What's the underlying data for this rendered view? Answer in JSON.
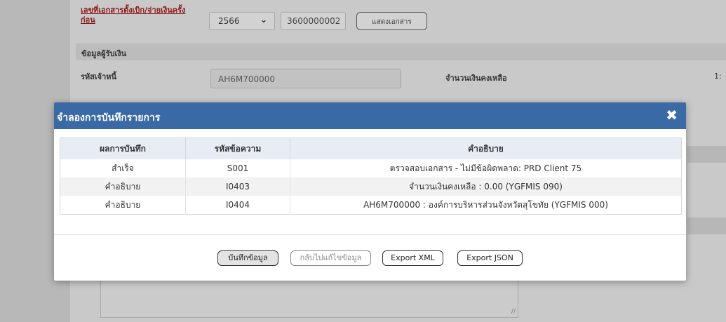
{
  "background": {
    "prev_doc_label": "เลขที่เอกสารตั้งเบิก/จ่ายเงินครั้งก่อน",
    "year_select_value": "2566",
    "doc_number_value": "3600000002",
    "show_doc_button": "แสดงเอกสาร",
    "section_title": "ข้อมูลผู้รับเงิน",
    "creditor_label": "รหัสเจ้าหนี้",
    "creditor_value": "AH6M700000",
    "remaining_label": "จำนวนเงินคงเหลือ",
    "remaining_value": "1:"
  },
  "modal": {
    "title": "จำลองการบันทึกรายการ",
    "table": {
      "headers": [
        "ผลการบันทึก",
        "รหัสข้อความ",
        "คำอธิบาย"
      ],
      "rows": [
        [
          "สำเร็จ",
          "S001",
          "ตรวจสอบเอกสาร - ไม่มีข้อผิดพลาด: PRD Client 75"
        ],
        [
          "คำอธิบาย",
          "I0403",
          "จำนวนเงินคงเหลือ : 0.00 (YGFMIS 090)"
        ],
        [
          "คำอธิบาย",
          "I0404",
          "AH6M700000 : องค์การบริหารส่วนจังหวัดสุโขทัย (YGFMIS 000)"
        ]
      ]
    },
    "buttons": {
      "save": "บันทึกข้อมูล",
      "back_edit": "กลับไปแก้ไขข้อมูล",
      "export_xml": "Export XML",
      "export_json": "Export JSON"
    }
  },
  "colors": {
    "header_blue": "#3a6aa6",
    "overlay_gray": "#c9c9c9"
  }
}
